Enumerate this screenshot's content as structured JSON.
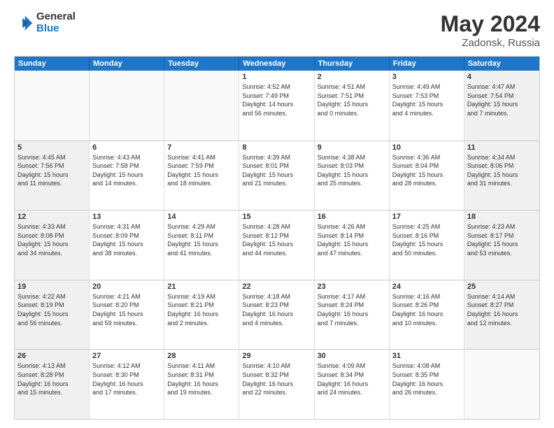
{
  "logo": {
    "general": "General",
    "blue": "Blue"
  },
  "title": "May 2024",
  "location": "Zadonsk, Russia",
  "days_of_week": [
    "Sunday",
    "Monday",
    "Tuesday",
    "Wednesday",
    "Thursday",
    "Friday",
    "Saturday"
  ],
  "weeks": [
    [
      {
        "day": "",
        "info": ""
      },
      {
        "day": "",
        "info": ""
      },
      {
        "day": "",
        "info": ""
      },
      {
        "day": "1",
        "info": "Sunrise: 4:52 AM\nSunset: 7:49 PM\nDaylight: 14 hours\nand 56 minutes."
      },
      {
        "day": "2",
        "info": "Sunrise: 4:51 AM\nSunset: 7:51 PM\nDaylight: 15 hours\nand 0 minutes."
      },
      {
        "day": "3",
        "info": "Sunrise: 4:49 AM\nSunset: 7:53 PM\nDaylight: 15 hours\nand 4 minutes."
      },
      {
        "day": "4",
        "info": "Sunrise: 4:47 AM\nSunset: 7:54 PM\nDaylight: 15 hours\nand 7 minutes."
      }
    ],
    [
      {
        "day": "5",
        "info": "Sunrise: 4:45 AM\nSunset: 7:56 PM\nDaylight: 15 hours\nand 11 minutes."
      },
      {
        "day": "6",
        "info": "Sunrise: 4:43 AM\nSunset: 7:58 PM\nDaylight: 15 hours\nand 14 minutes."
      },
      {
        "day": "7",
        "info": "Sunrise: 4:41 AM\nSunset: 7:59 PM\nDaylight: 15 hours\nand 18 minutes."
      },
      {
        "day": "8",
        "info": "Sunrise: 4:39 AM\nSunset: 8:01 PM\nDaylight: 15 hours\nand 21 minutes."
      },
      {
        "day": "9",
        "info": "Sunrise: 4:38 AM\nSunset: 8:03 PM\nDaylight: 15 hours\nand 25 minutes."
      },
      {
        "day": "10",
        "info": "Sunrise: 4:36 AM\nSunset: 8:04 PM\nDaylight: 15 hours\nand 28 minutes."
      },
      {
        "day": "11",
        "info": "Sunrise: 4:34 AM\nSunset: 8:06 PM\nDaylight: 15 hours\nand 31 minutes."
      }
    ],
    [
      {
        "day": "12",
        "info": "Sunrise: 4:33 AM\nSunset: 8:08 PM\nDaylight: 15 hours\nand 34 minutes."
      },
      {
        "day": "13",
        "info": "Sunrise: 4:31 AM\nSunset: 8:09 PM\nDaylight: 15 hours\nand 38 minutes."
      },
      {
        "day": "14",
        "info": "Sunrise: 4:29 AM\nSunset: 8:11 PM\nDaylight: 15 hours\nand 41 minutes."
      },
      {
        "day": "15",
        "info": "Sunrise: 4:28 AM\nSunset: 8:12 PM\nDaylight: 15 hours\nand 44 minutes."
      },
      {
        "day": "16",
        "info": "Sunrise: 4:26 AM\nSunset: 8:14 PM\nDaylight: 15 hours\nand 47 minutes."
      },
      {
        "day": "17",
        "info": "Sunrise: 4:25 AM\nSunset: 8:16 PM\nDaylight: 15 hours\nand 50 minutes."
      },
      {
        "day": "18",
        "info": "Sunrise: 4:23 AM\nSunset: 8:17 PM\nDaylight: 15 hours\nand 53 minutes."
      }
    ],
    [
      {
        "day": "19",
        "info": "Sunrise: 4:22 AM\nSunset: 8:19 PM\nDaylight: 15 hours\nand 56 minutes."
      },
      {
        "day": "20",
        "info": "Sunrise: 4:21 AM\nSunset: 8:20 PM\nDaylight: 15 hours\nand 59 minutes."
      },
      {
        "day": "21",
        "info": "Sunrise: 4:19 AM\nSunset: 8:21 PM\nDaylight: 16 hours\nand 2 minutes."
      },
      {
        "day": "22",
        "info": "Sunrise: 4:18 AM\nSunset: 8:23 PM\nDaylight: 16 hours\nand 4 minutes."
      },
      {
        "day": "23",
        "info": "Sunrise: 4:17 AM\nSunset: 8:24 PM\nDaylight: 16 hours\nand 7 minutes."
      },
      {
        "day": "24",
        "info": "Sunrise: 4:16 AM\nSunset: 8:26 PM\nDaylight: 16 hours\nand 10 minutes."
      },
      {
        "day": "25",
        "info": "Sunrise: 4:14 AM\nSunset: 8:27 PM\nDaylight: 16 hours\nand 12 minutes."
      }
    ],
    [
      {
        "day": "26",
        "info": "Sunrise: 4:13 AM\nSunset: 8:28 PM\nDaylight: 16 hours\nand 15 minutes."
      },
      {
        "day": "27",
        "info": "Sunrise: 4:12 AM\nSunset: 8:30 PM\nDaylight: 16 hours\nand 17 minutes."
      },
      {
        "day": "28",
        "info": "Sunrise: 4:11 AM\nSunset: 8:31 PM\nDaylight: 16 hours\nand 19 minutes."
      },
      {
        "day": "29",
        "info": "Sunrise: 4:10 AM\nSunset: 8:32 PM\nDaylight: 16 hours\nand 22 minutes."
      },
      {
        "day": "30",
        "info": "Sunrise: 4:09 AM\nSunset: 8:34 PM\nDaylight: 16 hours\nand 24 minutes."
      },
      {
        "day": "31",
        "info": "Sunrise: 4:08 AM\nSunset: 8:35 PM\nDaylight: 16 hours\nand 26 minutes."
      },
      {
        "day": "",
        "info": ""
      }
    ]
  ]
}
